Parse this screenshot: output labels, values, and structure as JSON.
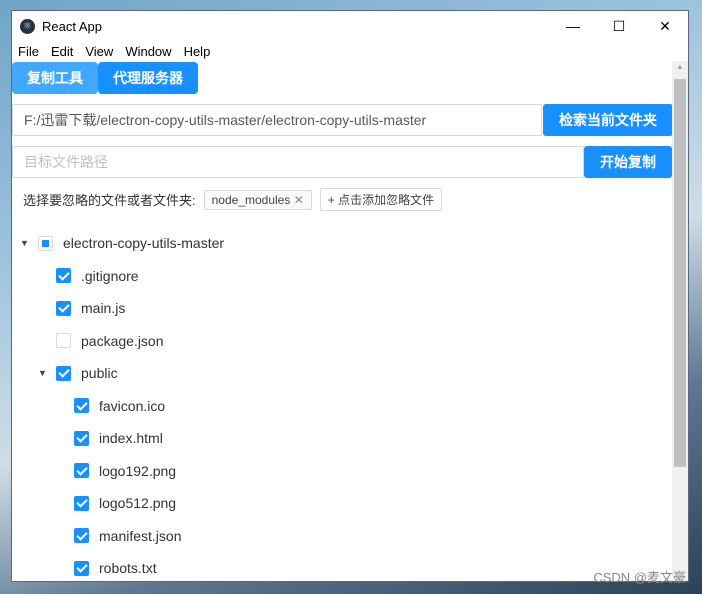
{
  "window": {
    "title": "React App",
    "icon": "electron-icon",
    "controls": [
      "minimize-icon",
      "maximize-icon",
      "close-icon"
    ]
  },
  "menu": [
    "File",
    "Edit",
    "View",
    "Window",
    "Help"
  ],
  "tabs": [
    {
      "label": "复制工具",
      "active": false
    },
    {
      "label": "代理服务器",
      "active": true
    }
  ],
  "source": {
    "value": "F:/迅雷下载/electron-copy-utils-master/electron-copy-utils-master",
    "button": "检索当前文件夹"
  },
  "target": {
    "placeholder": "目标文件路径",
    "button": "开始复制"
  },
  "ignore": {
    "label": "选择要忽略的文件或者文件夹:",
    "tags": [
      "node_modules"
    ],
    "add": "+ 点击添加忽略文件"
  },
  "tree": [
    {
      "label": "electron-copy-utils-master",
      "level": 0,
      "state": "indeterminate",
      "expanded": true
    },
    {
      "label": ".gitignore",
      "level": 1,
      "state": "checked"
    },
    {
      "label": "main.js",
      "level": 1,
      "state": "checked"
    },
    {
      "label": "package.json",
      "level": 1,
      "state": "unchecked"
    },
    {
      "label": "public",
      "level": 1,
      "state": "checked",
      "expanded": true
    },
    {
      "label": "favicon.ico",
      "level": 2,
      "state": "checked"
    },
    {
      "label": "index.html",
      "level": 2,
      "state": "checked"
    },
    {
      "label": "logo192.png",
      "level": 2,
      "state": "checked"
    },
    {
      "label": "logo512.png",
      "level": 2,
      "state": "checked"
    },
    {
      "label": "manifest.json",
      "level": 2,
      "state": "checked"
    },
    {
      "label": "robots.txt",
      "level": 2,
      "state": "checked"
    }
  ],
  "colors": {
    "primary": "#1890ff",
    "tab_inactive": "#40a9ff"
  },
  "watermark": "CSDN @麦文豪"
}
